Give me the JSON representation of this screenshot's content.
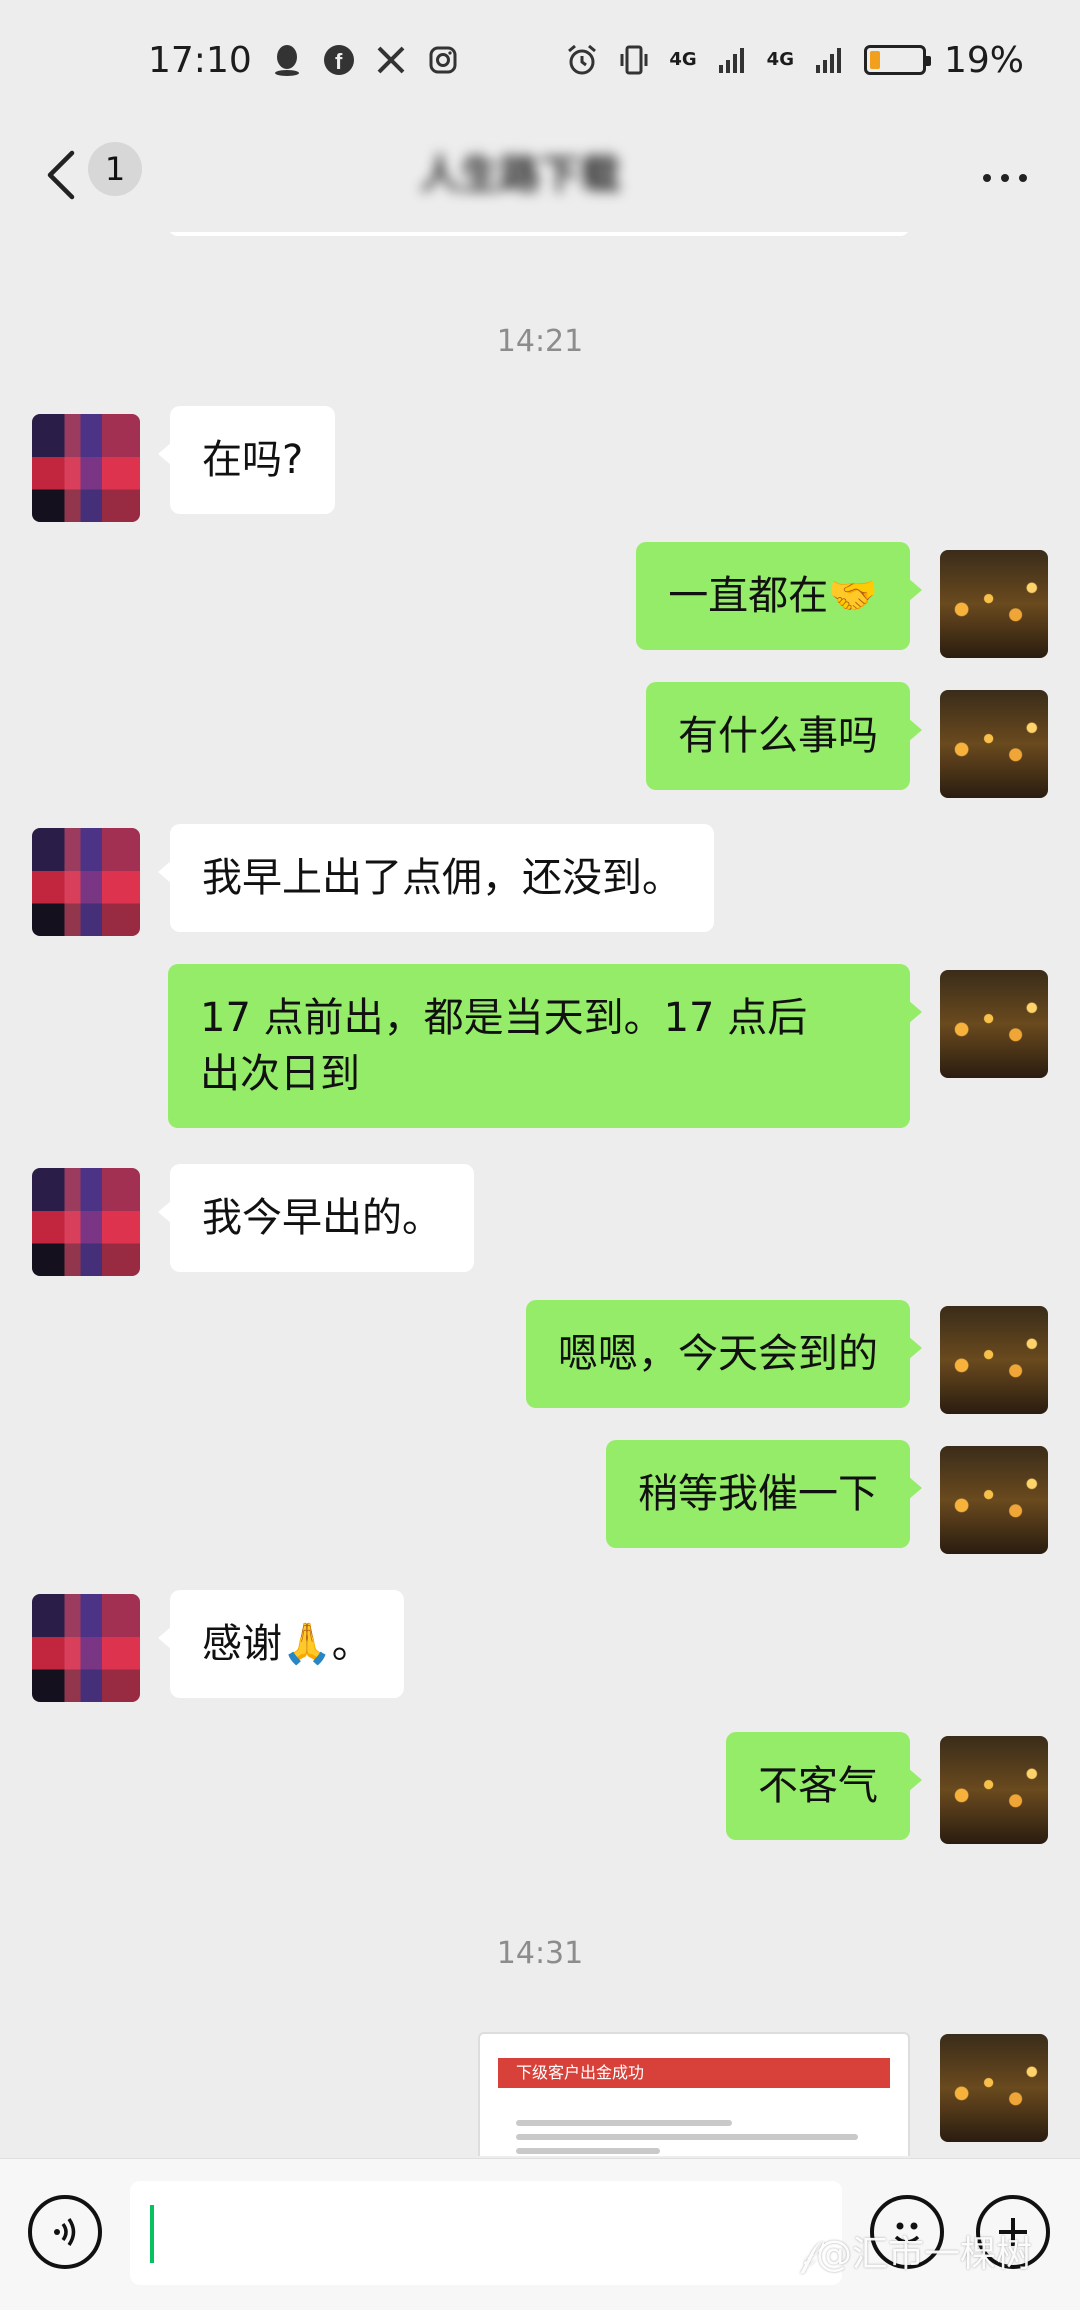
{
  "status_bar": {
    "time": "17:10",
    "net1": "4G",
    "net2": "4G",
    "battery_text": "19%",
    "battery_level": 0.19,
    "icons": [
      "qq-icon",
      "facebook-icon",
      "x-icon",
      "instagram-icon",
      "alarm-icon",
      "vibrate-icon",
      "signal-icon",
      "signal-icon",
      "battery-icon"
    ]
  },
  "header": {
    "back_icon": "chevron-left-icon",
    "unread_count": "1",
    "title": "人生路下载",
    "more_icon": "more-icon"
  },
  "chat": {
    "timestamp_1": "14:21",
    "timestamp_2": "14:31",
    "messages": [
      {
        "side": "left",
        "text": "在吗?"
      },
      {
        "side": "right",
        "text": "一直都在🤝"
      },
      {
        "side": "right",
        "text": "有什么事吗"
      },
      {
        "side": "left",
        "text": "我早上出了点佣，还没到。"
      },
      {
        "side": "right",
        "text": "17 点前出，都是当天到。17 点后\n出次日到"
      },
      {
        "side": "left",
        "text": "我今早出的。"
      },
      {
        "side": "right",
        "text": "嗯嗯，今天会到的"
      },
      {
        "side": "right",
        "text": "稍等我催一下"
      },
      {
        "side": "left",
        "text": "感谢🙏。"
      },
      {
        "side": "right",
        "text": "不客气"
      }
    ],
    "image_message": {
      "header_text": "下级客户出金成功"
    }
  },
  "input_bar": {
    "voice_icon": "voice-icon",
    "emoji_icon": "emoji-icon",
    "plus_icon": "plus-icon"
  },
  "watermark": "𝒻@汇市一棵树"
}
